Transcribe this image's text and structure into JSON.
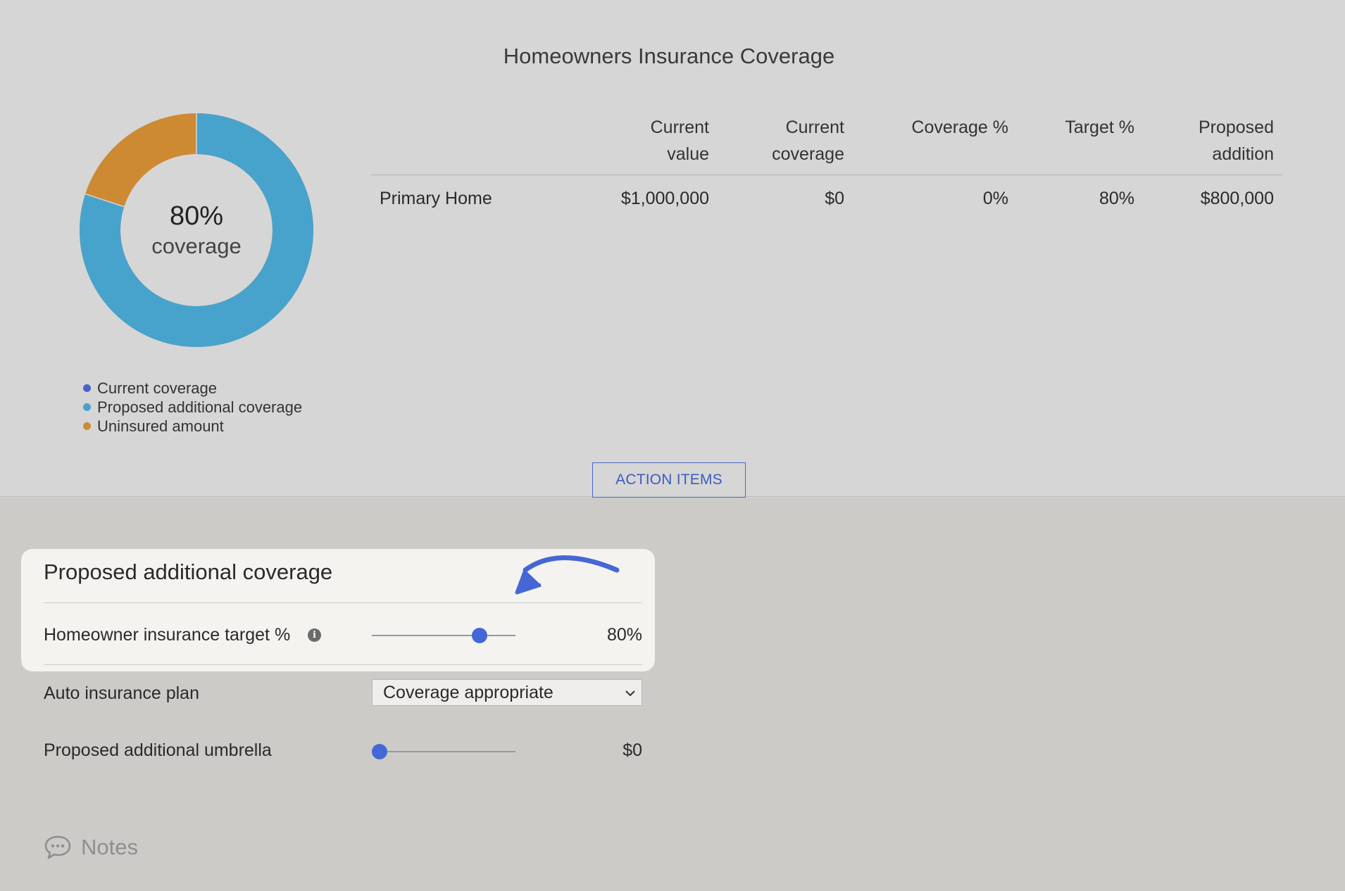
{
  "header": {
    "title": "Homeowners Insurance Coverage"
  },
  "donut": {
    "center_value": "80%",
    "center_label": "coverage",
    "coverage_fraction": 0.8,
    "colors": {
      "proposed": "#47a3cc",
      "uninsured": "#cd8a33",
      "current": "#4a62c8"
    }
  },
  "legend": {
    "items": [
      {
        "label": "Current coverage",
        "color": "#4a62c8"
      },
      {
        "label": "Proposed additional coverage",
        "color": "#47a3cc"
      },
      {
        "label": "Uninsured amount",
        "color": "#cd8a33"
      }
    ]
  },
  "table": {
    "headers": [
      {
        "line1": "",
        "line2": ""
      },
      {
        "line1": "Current",
        "line2": "value"
      },
      {
        "line1": "Current",
        "line2": "coverage"
      },
      {
        "line1": "Coverage %",
        "line2": ""
      },
      {
        "line1": "Target %",
        "line2": ""
      },
      {
        "line1": "Proposed",
        "line2": "addition"
      }
    ],
    "rows": [
      [
        "Primary Home",
        "$1,000,000",
        "$0",
        "0%",
        "80%",
        "$800,000"
      ]
    ]
  },
  "action_button": {
    "label": "ACTION ITEMS"
  },
  "proposed": {
    "title": "Proposed additional coverage",
    "target": {
      "label": "Homeowner insurance target %",
      "value": "80%",
      "slider_fraction": 0.78
    },
    "auto": {
      "label": "Auto insurance plan",
      "selected": "Coverage appropriate"
    },
    "umbrella": {
      "label": "Proposed additional umbrella",
      "value": "$0",
      "slider_fraction": 0.0
    }
  },
  "notes": {
    "label": "Notes"
  },
  "accent_color": "#4567d6"
}
